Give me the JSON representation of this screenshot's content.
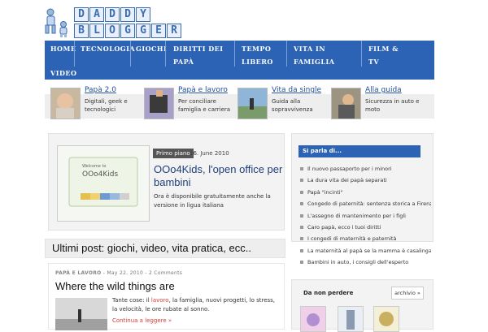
{
  "header": {
    "logo_line1": "DADDY",
    "logo_line2": "BLOGGER"
  },
  "nav": {
    "items": [
      "Home",
      "Tecnologia",
      "Giochi",
      "Diritti dei papà",
      "Tempo libero",
      "Vita in famiglia",
      "Film & TV",
      "Video"
    ]
  },
  "featured": [
    {
      "title": "Papà 2.0",
      "subtitle": "Digitali, geek e tecnologici"
    },
    {
      "title": "Papà e lavoro",
      "subtitle": "Per conciliare famiglia e carriera"
    },
    {
      "title": "Vita da single",
      "subtitle": "Guida alla sopravvivenza"
    },
    {
      "title": "Alla guida",
      "subtitle": "Sicurezza in auto e moto"
    }
  ],
  "primo_piano": {
    "badge": "Primo piano",
    "date": "16. June 2010",
    "title": "OOo4Kids, l'open office per bambini",
    "excerpt": "Ora è disponibile gratuitamente anche la versione in ligua italiana",
    "image_text": "Welcome to",
    "image_brand": "OOo4Kids"
  },
  "ultimi": {
    "heading": "Ultimi post: giochi, video, vita pratica, ecc.."
  },
  "post": {
    "category": "Papà e lavoro",
    "meta": " - May 22, 2010 - 2 Comments",
    "title": "Where the wild things are",
    "text_before": "Tante cose: il ",
    "text_link": "lavoro",
    "text_after": ", la famiglia, nuovi progetti, lo stress, la velocità, le ore rubate al sonno.",
    "more": "Continua a leggere »"
  },
  "sidebar": {
    "header": "Si parla di...",
    "items": [
      "Il nuovo passaporto per i minori",
      "La dura vita dei papà separati",
      "Papà \"incinti\"",
      "Congedo di paternità: sentenza storica a Firenze",
      "L'assegno di mantenimento per i figli",
      "Caro papà, ecco i tuoi diritti",
      "I congedi di maternità e paternità",
      "La maternità al papà se la mamma è casalinga",
      "Bambini in auto, i consigli dell'esperto"
    ],
    "box2_title": "Da non perdere",
    "box2_button": "archivio »"
  },
  "colors": {
    "nav_blue": "#2d63b5",
    "link_red": "#d83b3b",
    "title_blue": "#1f3f7a"
  }
}
